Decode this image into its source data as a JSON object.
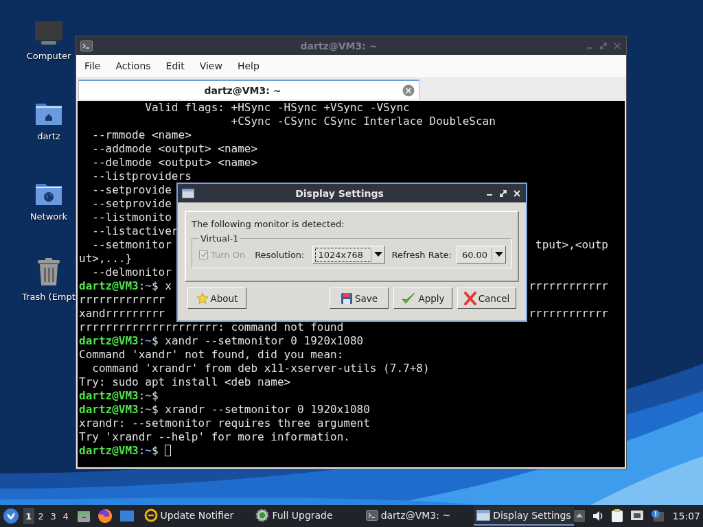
{
  "desktop_icons": [
    {
      "label": "Computer",
      "kind": "computer"
    },
    {
      "label": "dartz",
      "kind": "home"
    },
    {
      "label": "Network",
      "kind": "network"
    },
    {
      "label": "Trash (Empt",
      "kind": "trash"
    }
  ],
  "terminal": {
    "title": "dartz@VM3: ~",
    "active": false,
    "menu": [
      "File",
      "Actions",
      "Edit",
      "View",
      "Help"
    ],
    "tabs": [
      {
        "label": "dartz@VM3: ~",
        "selected": true
      }
    ],
    "lines": [
      {
        "kind": "output",
        "text": "          Valid flags: +HSync -HSync +VSync -VSync"
      },
      {
        "kind": "output",
        "text": "                       +CSync -CSync CSync Interlace DoubleScan"
      },
      {
        "kind": "output",
        "text": "  --rmmode <name>"
      },
      {
        "kind": "output",
        "text": "  --addmode <output> <name>"
      },
      {
        "kind": "output",
        "text": "  --delmode <output> <name>"
      },
      {
        "kind": "output",
        "text": "  --listproviders"
      },
      {
        "kind": "output",
        "text": "  --setprovide"
      },
      {
        "kind": "output",
        "text": "  --setprovide"
      },
      {
        "kind": "output",
        "text": "  --listmonito"
      },
      {
        "kind": "output",
        "text": "  --listactiver"
      },
      {
        "kind": "output",
        "text": "  --setmonitor",
        "right": "tput>,<outp"
      },
      {
        "kind": "output",
        "text": "ut>,...}"
      },
      {
        "kind": "output",
        "text": "  --delmonitor"
      },
      {
        "kind": "prompt",
        "user": "dartz@VM3",
        "sep": ":",
        "path": "~",
        "sign": "$",
        "text": " x",
        "right": "rrrrrrrrrrrr"
      },
      {
        "kind": "output",
        "text": "rrrrrrrrrrrrr"
      },
      {
        "kind": "output",
        "text": "xandrrrrrrrrr",
        "right": "rrrrrrrrrrrr"
      },
      {
        "kind": "output",
        "text": "rrrrrrrrrrrrrrrrrrrrr: command not found"
      },
      {
        "kind": "prompt",
        "user": "dartz@VM3",
        "sep": ":",
        "path": "~",
        "sign": "$",
        "text": " xandr --setmonitor 0 1920x1080"
      },
      {
        "kind": "output",
        "text": "Command 'xandr' not found, did you mean:"
      },
      {
        "kind": "output",
        "text": "  command 'xrandr' from deb x11-xserver-utils (7.7+8)"
      },
      {
        "kind": "output",
        "text": "Try: sudo apt install <deb name>"
      },
      {
        "kind": "prompt",
        "user": "dartz@VM3",
        "sep": ":",
        "path": "~",
        "sign": "$"
      },
      {
        "kind": "prompt",
        "user": "dartz@VM3",
        "sep": ":",
        "path": "~",
        "sign": "$",
        "text": " xrandr --setmonitor 0 1920x1080"
      },
      {
        "kind": "output",
        "text": "xrandr: --setmonitor requires three argument"
      },
      {
        "kind": "output",
        "text": "Try 'xrandr --help' for more information."
      },
      {
        "kind": "prompt",
        "user": "dartz@VM3",
        "sep": ":",
        "path": "~",
        "sign": "$",
        "cursor": true
      }
    ]
  },
  "dialog": {
    "title": "Display Settings",
    "active": true,
    "message": "The following monitor is detected:",
    "monitor": {
      "name": "Virtual-1",
      "turn_on": {
        "label": "Turn On",
        "checked": true,
        "disabled": true
      },
      "resolution": {
        "label": "Resolution:",
        "value": "1024x768",
        "focused": true
      },
      "refresh_rate": {
        "label": "Refresh Rate:",
        "value": "60.00",
        "focused": false
      }
    },
    "buttons": [
      {
        "label": "About",
        "kind": "about"
      },
      {
        "label": "Save",
        "kind": "save"
      },
      {
        "label": "Apply",
        "kind": "apply"
      },
      {
        "label": "Cancel",
        "kind": "cancel"
      }
    ]
  },
  "taskbar": {
    "workspaces": [
      {
        "label": "1",
        "selected": true
      },
      {
        "label": "2",
        "selected": false
      },
      {
        "label": "3",
        "selected": false
      },
      {
        "label": "4",
        "selected": false
      }
    ],
    "tasks": [
      {
        "label": "Update Notifier",
        "kind": "update",
        "selected": false
      },
      {
        "label": "Full Upgrade",
        "kind": "upgrade",
        "selected": false
      },
      {
        "label": "dartz@VM3: ~",
        "kind": "terminal",
        "selected": false
      },
      {
        "label": "Display Settings",
        "kind": "display",
        "selected": true
      }
    ],
    "clock": "15:07"
  }
}
